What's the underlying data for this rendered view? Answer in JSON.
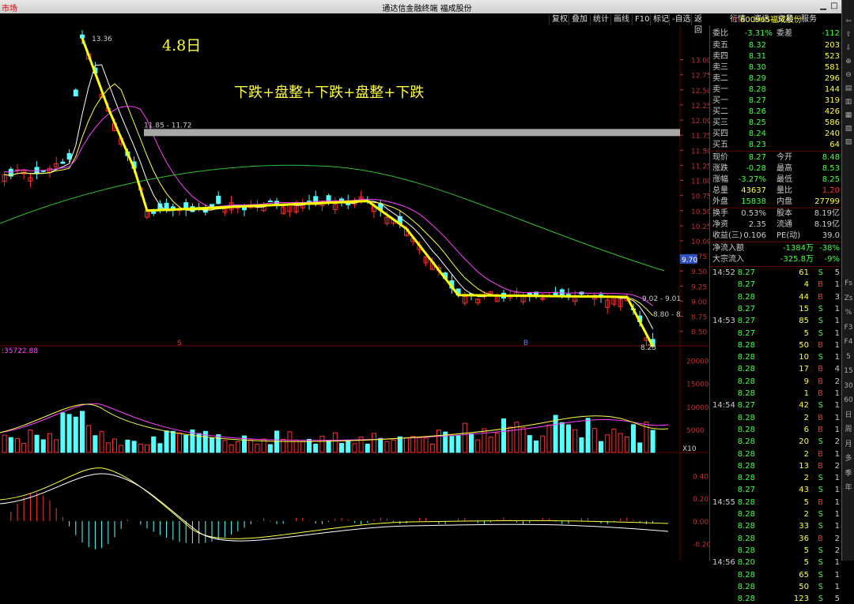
{
  "window": {
    "title": "通达信金融终端  福成股份",
    "left_label": "市场"
  },
  "toolbar": [
    "复权",
    "叠加",
    "统计",
    "画线",
    "F10",
    "标记",
    "-自选",
    "返回"
  ],
  "right_tabs": [
    "行情",
    "资讯",
    "交易",
    "服务"
  ],
  "stock": {
    "code": "600965",
    "name": "福成股份",
    "badge": "R"
  },
  "order_book": {
    "weibi_label": "委比",
    "weibi": "-3.31%",
    "weicha_label": "委差",
    "weicha": "-112",
    "asks": [
      {
        "label": "卖五",
        "price": "8.32",
        "vol": "203"
      },
      {
        "label": "卖四",
        "price": "8.31",
        "vol": "523"
      },
      {
        "label": "卖三",
        "price": "8.30",
        "vol": "581"
      },
      {
        "label": "卖二",
        "price": "8.29",
        "vol": "296"
      },
      {
        "label": "卖一",
        "price": "8.28",
        "vol": "144"
      }
    ],
    "bids": [
      {
        "label": "买一",
        "price": "8.27",
        "vol": "319"
      },
      {
        "label": "买二",
        "price": "8.26",
        "vol": "426"
      },
      {
        "label": "买三",
        "price": "8.25",
        "vol": "586"
      },
      {
        "label": "买四",
        "price": "8.24",
        "vol": "240"
      },
      {
        "label": "买五",
        "price": "8.23",
        "vol": "64"
      }
    ]
  },
  "quote": [
    {
      "l1": "现价",
      "v1": "8.27",
      "l2": "今开",
      "v2": "8.48"
    },
    {
      "l1": "涨跌",
      "v1": "-0.28",
      "l2": "最高",
      "v2": "8.53"
    },
    {
      "l1": "涨幅",
      "v1": "-3.27%",
      "l2": "最低",
      "v2": "8.25"
    },
    {
      "l1": "总量",
      "v1": "43637",
      "l2": "量比",
      "v2": "1.20"
    },
    {
      "l1": "外盘",
      "v1": "15838",
      "l2": "内盘",
      "v2": "27799"
    }
  ],
  "stats": [
    {
      "l1": "换手",
      "v1": "0.53%",
      "l2": "股本",
      "v2": "8.19亿"
    },
    {
      "l1": "净资",
      "v1": "2.35",
      "l2": "流通",
      "v2": "8.19亿"
    },
    {
      "l1": "收益(三)",
      "v1": "0.106",
      "l2": "PE(动)",
      "v2": "39.0"
    }
  ],
  "flows": [
    {
      "label": "净流入额",
      "val": "-1384万",
      "pct": "-38%"
    },
    {
      "label": "大宗流入",
      "val": "-325.8万",
      "pct": "-9%"
    }
  ],
  "ticks": [
    {
      "time": "14:52",
      "p": "8.27",
      "v": "61",
      "s": "S",
      "n": "5"
    },
    {
      "time": "",
      "p": "8.27",
      "v": "4",
      "s": "B",
      "n": "1"
    },
    {
      "time": "",
      "p": "8.28",
      "v": "44",
      "s": "B",
      "n": "3"
    },
    {
      "time": "",
      "p": "8.27",
      "v": "15",
      "s": "S",
      "n": "1"
    },
    {
      "time": "14:53",
      "p": "8.27",
      "v": "85",
      "s": "S",
      "n": "1"
    },
    {
      "time": "",
      "p": "8.27",
      "v": "5",
      "s": "S",
      "n": "1"
    },
    {
      "time": "",
      "p": "8.28",
      "v": "50",
      "s": "B",
      "n": "1"
    },
    {
      "time": "",
      "p": "8.28",
      "v": "10",
      "s": "S",
      "n": "1"
    },
    {
      "time": "",
      "p": "8.28",
      "v": "17",
      "s": "B",
      "n": "4"
    },
    {
      "time": "",
      "p": "8.28",
      "v": "9",
      "s": "B",
      "n": "2"
    },
    {
      "time": "",
      "p": "8.28",
      "v": "1",
      "s": "B",
      "n": "1"
    },
    {
      "time": "14:54",
      "p": "8.27",
      "v": "42",
      "s": "S",
      "n": "1"
    },
    {
      "time": "",
      "p": "8.28",
      "v": "2",
      "s": "B",
      "n": "1"
    },
    {
      "time": "",
      "p": "8.28",
      "v": "6",
      "s": "B",
      "n": "1"
    },
    {
      "time": "",
      "p": "8.28",
      "v": "20",
      "s": "S",
      "n": "2"
    },
    {
      "time": "",
      "p": "8.28",
      "v": "2",
      "s": "B",
      "n": "1"
    },
    {
      "time": "",
      "p": "8.28",
      "v": "13",
      "s": "B",
      "n": "2"
    },
    {
      "time": "",
      "p": "8.28",
      "v": "2",
      "s": "S",
      "n": "1"
    },
    {
      "time": "",
      "p": "8.27",
      "v": "43",
      "s": "S",
      "n": "1"
    },
    {
      "time": "14:55",
      "p": "8.28",
      "v": "5",
      "s": "B",
      "n": "1"
    },
    {
      "time": "",
      "p": "8.28",
      "v": "2",
      "s": "S",
      "n": "1"
    },
    {
      "time": "",
      "p": "8.28",
      "v": "33",
      "s": "S",
      "n": "1"
    },
    {
      "time": "",
      "p": "8.28",
      "v": "36",
      "s": "B",
      "n": "2"
    },
    {
      "time": "",
      "p": "8.28",
      "v": "5",
      "s": "S",
      "n": "2"
    },
    {
      "time": "14:56",
      "p": "8.20",
      "v": "5",
      "s": "S",
      "n": "1"
    },
    {
      "time": "",
      "p": "8.28",
      "v": "65",
      "s": "S",
      "n": "1"
    },
    {
      "time": "",
      "p": "8.28",
      "v": "50",
      "s": "S",
      "n": "1"
    },
    {
      "time": "",
      "p": "8.28",
      "v": "123",
      "s": "S",
      "n": "5"
    }
  ],
  "side_buttons": [
    "Fs",
    "Zs",
    "%",
    "F3",
    "F4",
    "5",
    "15",
    "30",
    "60",
    "日",
    "周",
    "月",
    "多",
    "季",
    "年"
  ],
  "annotations": {
    "date": "4.8日",
    "pattern": "下跌+盘整+下跌+盘整+下跌",
    "high_label": "13.36",
    "band_label": "11.85 - 11.72",
    "range_label": "9.02 - 9.01",
    "current_label": "8.80 - 8",
    "low_label": "8.25",
    "axis_tag": "9.70",
    "vol_label": ":35722.88",
    "x10": "X10",
    "mark_s": "S",
    "mark_b": "B"
  },
  "chart_data": {
    "type": "candlestick",
    "price_axis": [
      "13.00",
      "12.75",
      "12.50",
      "12.25",
      "12.00",
      "11.75",
      "11.50",
      "11.25",
      "11.00",
      "10.75",
      "10.50",
      "10.25",
      "10.00",
      "9.75",
      "9.50",
      "9.25",
      "9.00",
      "8.75",
      "8.50"
    ],
    "volume_axis": [
      "20000",
      "15000",
      "10000",
      "5000"
    ],
    "macd_axis": [
      "0.40",
      "0.20",
      "0.00",
      "-0.20"
    ],
    "price_range": [
      8.3,
      13.4
    ],
    "volume_max": 22000,
    "macd_range": [
      -0.35,
      0.55
    ],
    "trend_points": [
      [
        0,
        13.36
      ],
      [
        2,
        12.2
      ],
      [
        4,
        11.2
      ],
      [
        5,
        10.5
      ],
      [
        22,
        10.66
      ],
      [
        25,
        10.2
      ],
      [
        29,
        9.1
      ],
      [
        42,
        9.07
      ],
      [
        44,
        8.25
      ]
    ]
  }
}
